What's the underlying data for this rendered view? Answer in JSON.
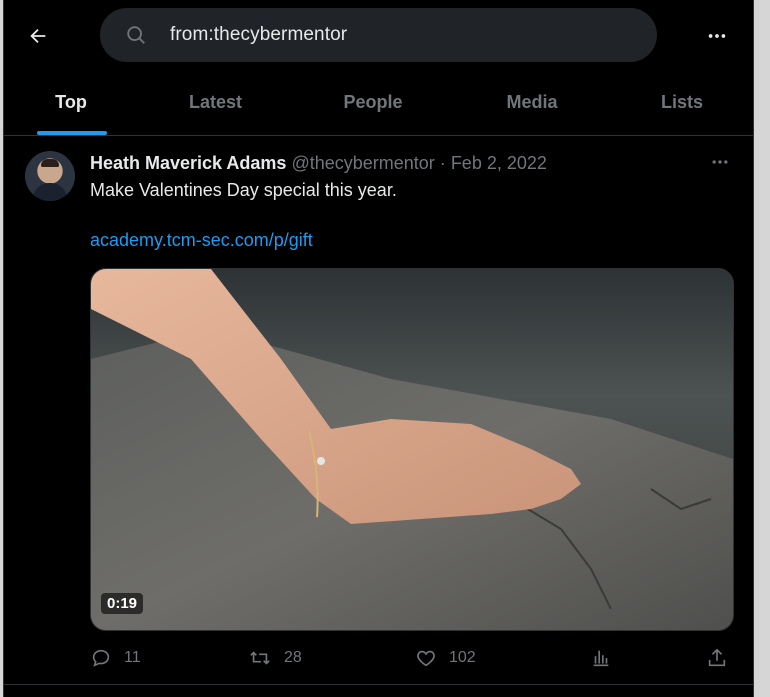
{
  "search": {
    "query": "from:thecybermentor"
  },
  "tabs": [
    {
      "label": "Top"
    },
    {
      "label": "Latest"
    },
    {
      "label": "People"
    },
    {
      "label": "Media"
    },
    {
      "label": "Lists"
    }
  ],
  "tweet": {
    "name": "Heath Maverick Adams",
    "handle": "@thecybermentor",
    "separator": "·",
    "date": "Feb 2, 2022",
    "text": "Make Valentines Day special this year.",
    "link": "academy.tcm-sec.com/p/gift",
    "video_duration": "0:19",
    "replies": "11",
    "retweets": "28",
    "likes": "102"
  },
  "colors": {
    "accent": "#1d9bf0",
    "background": "#000000",
    "muted": "#71767b"
  },
  "icons": [
    "back-arrow-icon",
    "search-icon",
    "more-horizontal-icon",
    "reply-icon",
    "retweet-icon",
    "like-icon",
    "views-icon",
    "share-icon"
  ]
}
